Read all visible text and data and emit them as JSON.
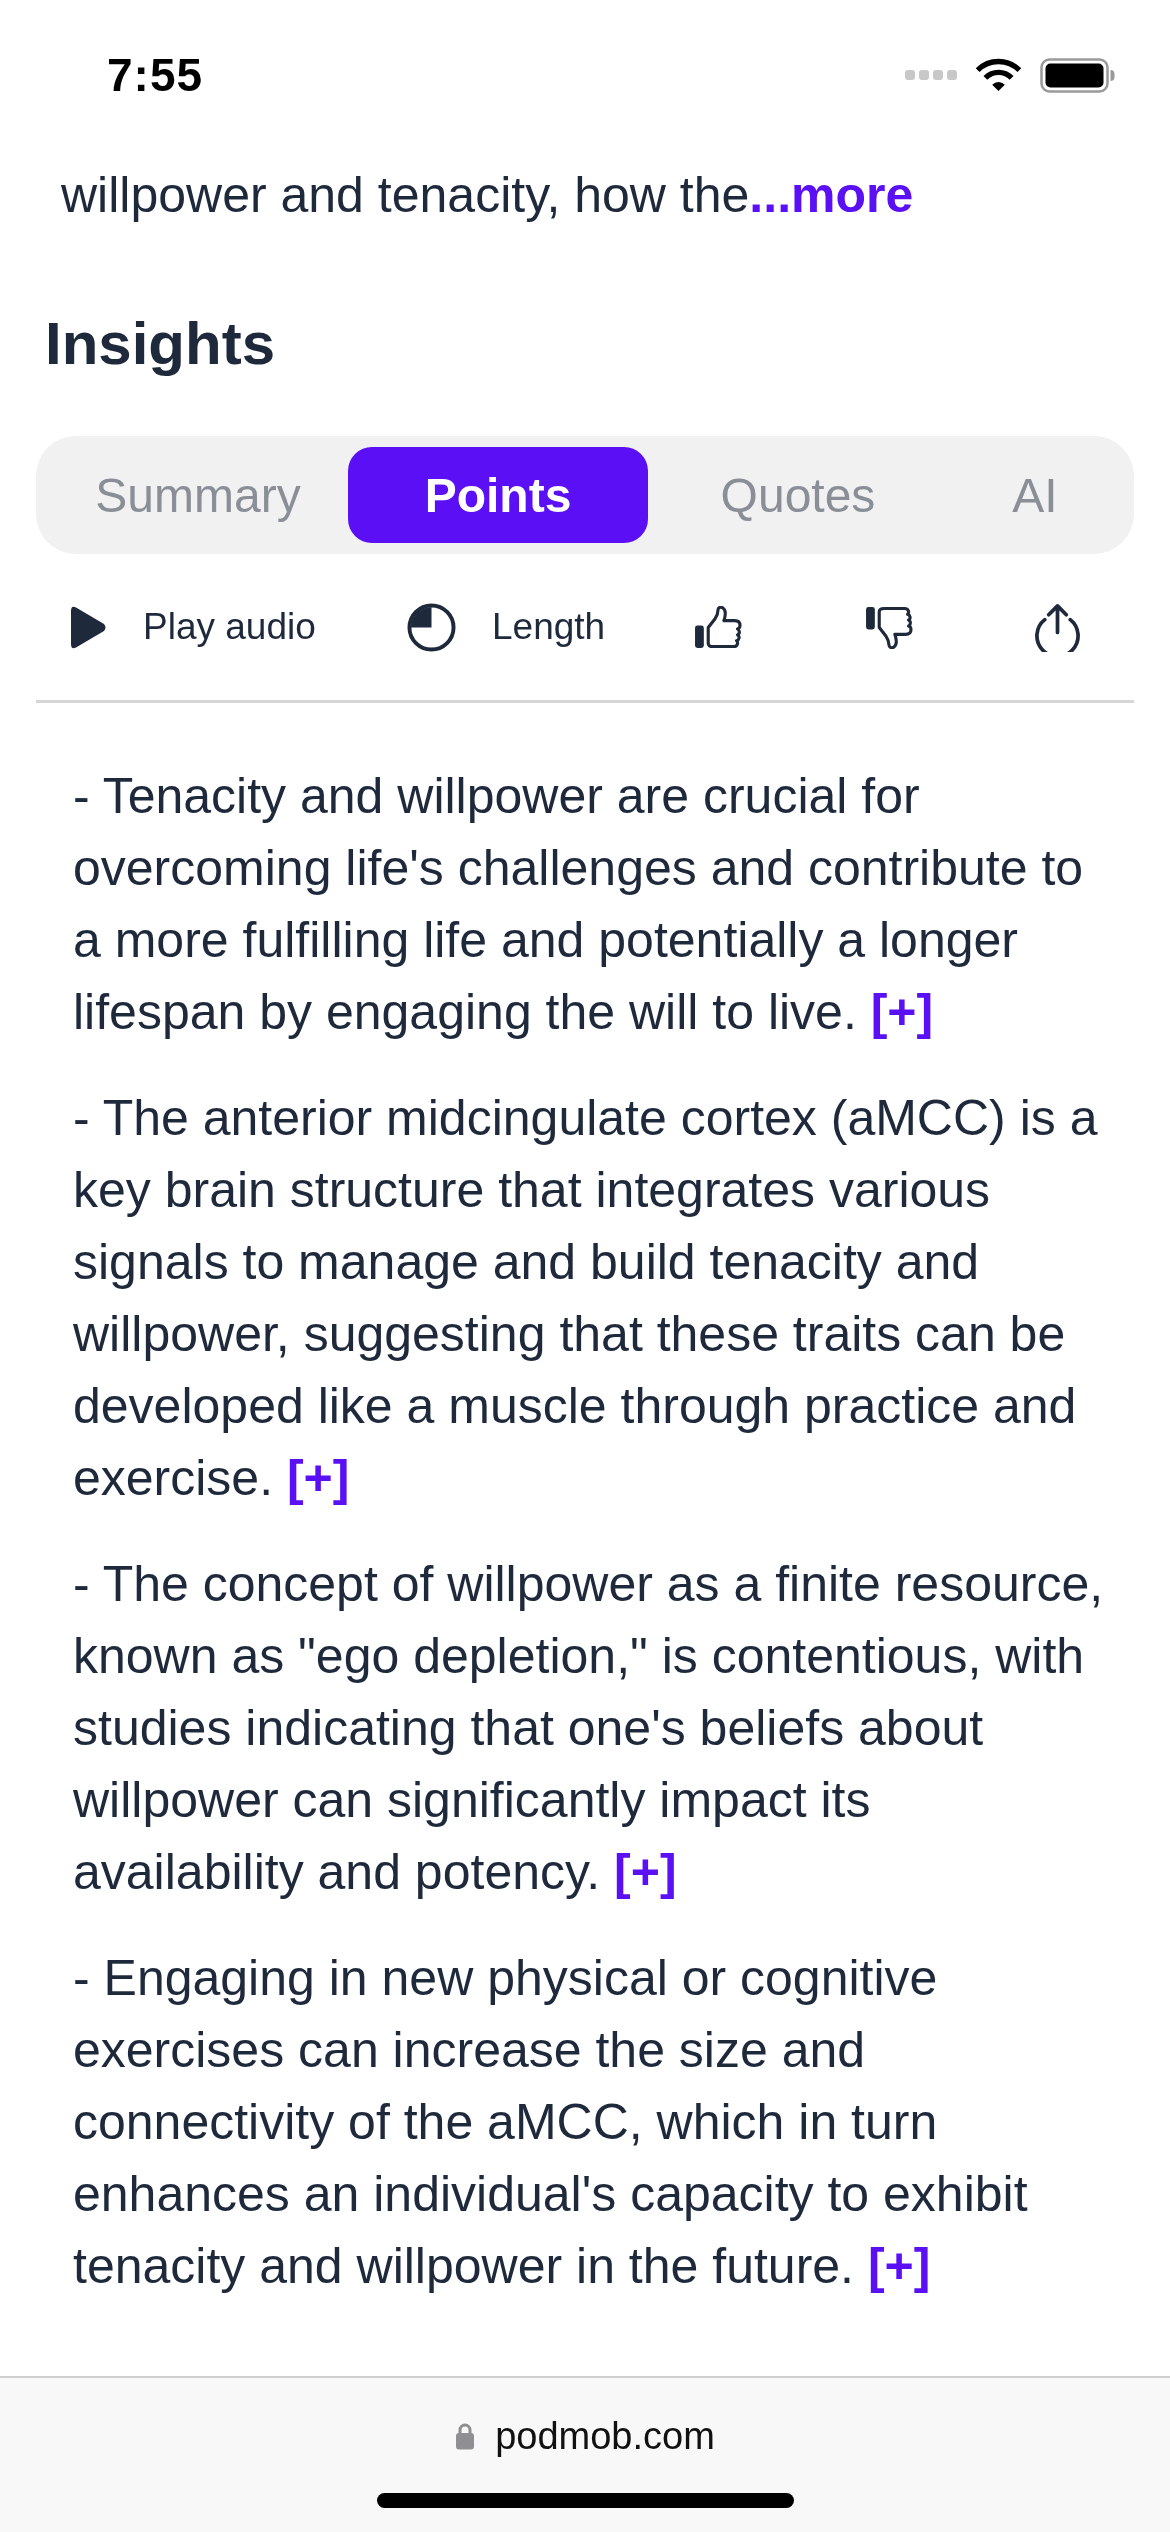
{
  "status_bar": {
    "time": "7:55"
  },
  "description": {
    "text": "willpower and tenacity, how the",
    "more_label": "...more"
  },
  "insights": {
    "title": "Insights",
    "tabs": [
      {
        "label": "Summary",
        "selected": false
      },
      {
        "label": "Points",
        "selected": true
      },
      {
        "label": "Quotes",
        "selected": false
      },
      {
        "label": "AI",
        "selected": false
      }
    ],
    "toolbar": [
      {
        "kind": "play",
        "label": "Play audio"
      },
      {
        "kind": "length",
        "label": "Length"
      },
      {
        "kind": "like"
      },
      {
        "kind": "dislike"
      },
      {
        "kind": "share"
      }
    ],
    "points": [
      {
        "text": "- Tenacity and willpower are crucial for overcoming life's challenges and contribute to a more fulfilling life and potentially a longer lifespan by engaging the will to live.",
        "expand_label": "[+]"
      },
      {
        "text": "- The anterior midcingulate cortex (aMCC) is a key brain structure that integrates various signals to manage and build tenacity and willpower, suggesting that these traits can be developed like a muscle through practice and exercise.",
        "expand_label": "[+]"
      },
      {
        "text": "- The concept of willpower as a finite resource, known as \"ego depletion,\" is contentious, with studies indicating that one's beliefs about willpower can significantly impact its availability and potency.",
        "expand_label": "[+]"
      },
      {
        "text": "- Engaging in new physical or cognitive exercises can increase the size and connectivity of the aMCC, which in turn enhances an individual's capacity to exhibit tenacity and willpower in the future.",
        "expand_label": "[+]"
      }
    ]
  },
  "browser_bar": {
    "url": "podmob.com"
  }
}
